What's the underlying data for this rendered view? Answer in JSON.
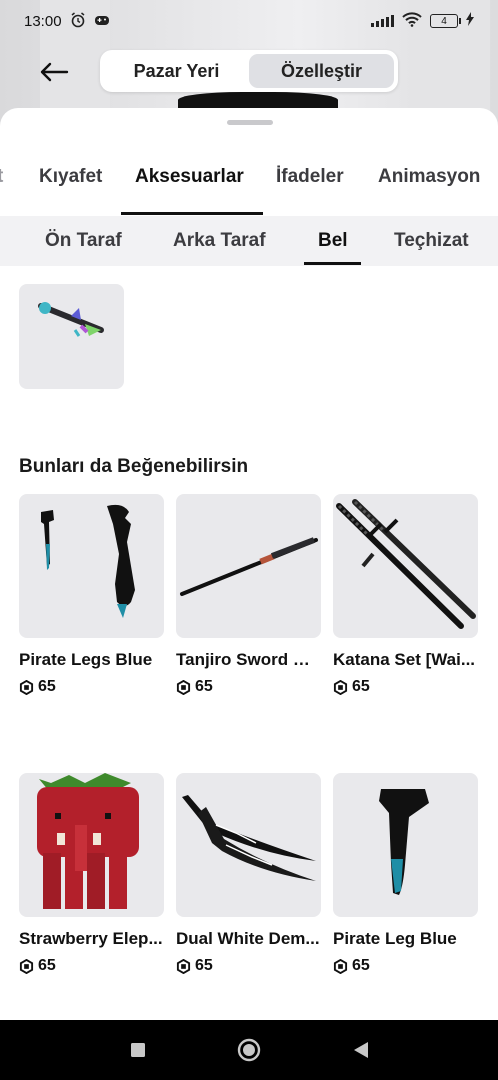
{
  "status_bar": {
    "time": "13:00",
    "battery": "4",
    "icons": [
      "alarm-icon",
      "game-controller-icon",
      "signal-icon",
      "wifi-icon",
      "battery-icon",
      "charging-icon"
    ]
  },
  "header": {
    "back_icon": "back-arrow-icon",
    "segments": [
      {
        "label": "Pazar Yeri",
        "active": false
      },
      {
        "label": "Özelleştir",
        "active": true
      }
    ]
  },
  "tabs": [
    {
      "label": "t",
      "active": false
    },
    {
      "label": "Kıyafet",
      "active": false
    },
    {
      "label": "Aksesuarlar",
      "active": true
    },
    {
      "label": "İfadeler",
      "active": false
    },
    {
      "label": "Animasyon",
      "active": false
    }
  ],
  "subtabs": [
    {
      "label": "Ön Taraf",
      "active": false
    },
    {
      "label": "Arka Taraf",
      "active": false
    },
    {
      "label": "Bel",
      "active": true
    },
    {
      "label": "Teçhizat",
      "active": false
    }
  ],
  "owned_item": {
    "icon": "bel-accessory-icon"
  },
  "recommendations": {
    "title": "Bunları da Beğenebilirsin",
    "items": [
      {
        "name": "Pirate Legs Blue",
        "price": "65"
      },
      {
        "name": "Tanjiro Sword ⧉ ...",
        "price": "65"
      },
      {
        "name": "Katana Set [Wai...",
        "price": "65"
      },
      {
        "name": "Strawberry Elep...",
        "price": "65"
      },
      {
        "name": "Dual White Dem...",
        "price": "65"
      },
      {
        "name": "Pirate Leg Blue",
        "price": "65"
      }
    ]
  },
  "navigation": {
    "buttons": [
      "recents-square-icon",
      "home-circle-icon",
      "back-triangle-icon"
    ]
  },
  "colors": {
    "text": "#111111",
    "tile_bg": "#e9e9ec",
    "subtab_bg": "#f2f2f4",
    "segment_active": "#dfe0e4"
  }
}
